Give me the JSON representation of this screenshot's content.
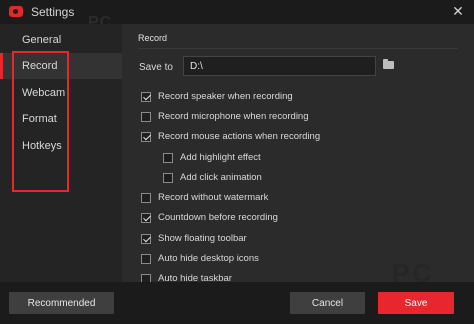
{
  "window": {
    "title": "Settings"
  },
  "sidebar": {
    "items": [
      {
        "label": "General"
      },
      {
        "label": "Record",
        "active": true
      },
      {
        "label": "Webcam"
      },
      {
        "label": "Format"
      },
      {
        "label": "Hotkeys"
      }
    ]
  },
  "record": {
    "section_title": "Record",
    "save_to_label": "Save to",
    "save_to_value": "D:\\",
    "options": [
      {
        "label": "Record speaker when recording",
        "checked": true
      },
      {
        "label": "Record microphone when recording",
        "checked": false
      },
      {
        "label": "Record mouse actions when recording",
        "checked": true
      },
      {
        "label": "Add highlight effect",
        "checked": false
      },
      {
        "label": "Add click animation",
        "checked": false
      },
      {
        "label": "Record without watermark",
        "checked": false
      },
      {
        "label": "Countdown before recording",
        "checked": true
      },
      {
        "label": "Show floating toolbar",
        "checked": true
      },
      {
        "label": "Auto hide desktop icons",
        "checked": false
      },
      {
        "label": "Auto hide taskbar",
        "checked": false
      }
    ]
  },
  "footer": {
    "recommended_label": "Recommended",
    "cancel_label": "Cancel",
    "save_label": "Save"
  },
  "watermarks": {
    "top": "PC",
    "bottom_right": "PC"
  },
  "colors": {
    "accent": "#e8262e",
    "background": "#2b2b2b",
    "sidebar": "#242424"
  },
  "icons": {
    "app": "recorder-icon",
    "close": "close-icon",
    "folder": "folder-icon"
  }
}
